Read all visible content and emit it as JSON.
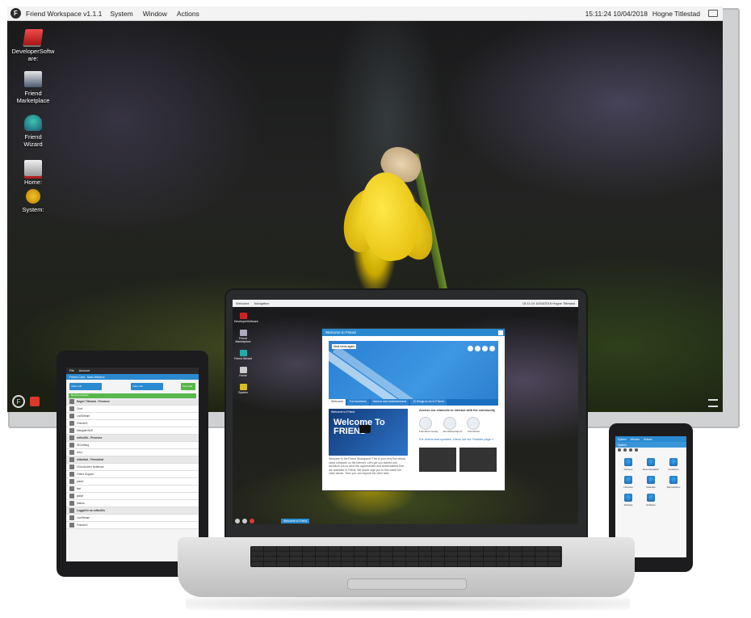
{
  "monitor": {
    "topbar": {
      "app_title": "Friend Workspace v1.1.1",
      "menus": [
        "System",
        "Window",
        "Actions"
      ],
      "clock": "15:11:24 10/04/2018",
      "user": "Hogne Titlestad"
    },
    "desktop_icons": [
      {
        "label": "DeveloperSoftware:",
        "icon": "developer-software-icon"
      },
      {
        "label": "Friend Marketplace",
        "icon": "marketplace-icon"
      },
      {
        "label": "Friend Wizard",
        "icon": "wizard-icon"
      },
      {
        "label": "Home:",
        "icon": "home-drive-icon"
      },
      {
        "label": "System:",
        "icon": "system-drive-icon"
      }
    ]
  },
  "laptop": {
    "topbar": {
      "menus": [
        "Welcome",
        "Navigation"
      ],
      "clock_user": "15:11:24 10/04/2018 Hogne Titlestad"
    },
    "desktop_icons": [
      "DeveloperSoftware",
      "Friend Marketplace",
      "Friend Wizard",
      "Home",
      "System"
    ],
    "window": {
      "title": "Welcome to Friend",
      "news_label": "Neat news again",
      "tabs": [
        "Welcome",
        "For business",
        "Games and entertainment",
        "10 things to do in Friend"
      ],
      "video_title": "Welcome To FRIEND",
      "video_caption": "Welcome to Friend",
      "channels_heading": "Access our channels to interact with the community",
      "channels": [
        "FriendCommunity",
        "FriendDevelopers",
        "FriendChat"
      ],
      "videos_heading": "For videos and updates, check out our Youtube page »",
      "intro_text": "Welcome to the Friend Workspace! This is your very first virtual cloud computer on the internet. Let's get you started and introduce you to all of the opportunities and functionalities that are available in Friend. We would urge you to first watch the video above. Then you can explore the other tabs."
    },
    "taskbar_item": "Welcome to Friend"
  },
  "tablet": {
    "menus": [
      "File",
      "Account"
    ],
    "header": "Friend Chat - Main Window",
    "buttons": [
      "Video call",
      "Voice call",
      "Text chat"
    ],
    "notice": "Recent contacts",
    "rows": [
      {
        "label": "Hogne Titlestad - Presence",
        "group": true
      },
      {
        "label": "Chat",
        "group": false
      },
      {
        "label": "LiveStream",
        "group": false
      },
      {
        "label": "FriendUS",
        "group": false
      },
      {
        "label": "Mangata Wolf",
        "group": false
      },
      {
        "label": "rolfsn20n - Presence",
        "group": true
      },
      {
        "label": "IRCnetting",
        "group": false
      },
      {
        "label": "Artur",
        "group": false
      },
      {
        "label": "olitestiad - Friendchat",
        "group": true
      },
      {
        "label": "Chris Andre's Notebook",
        "group": false
      },
      {
        "label": "Friend Support",
        "group": false
      },
      {
        "label": "pawel",
        "group": false
      },
      {
        "label": "test",
        "group": false
      },
      {
        "label": "jxdkel",
        "group": false
      },
      {
        "label": "Marius",
        "group": false
      },
      {
        "label": "Logged in as rolfsn20n",
        "group": true
      },
      {
        "label": "LiveStream",
        "group": false
      },
      {
        "label": "FriendUS",
        "group": false
      }
    ]
  },
  "phone": {
    "menus": [
      "System",
      "Window",
      "Actions"
    ],
    "title": "System",
    "apps": [
      "Devices",
      "Documentation",
      "Functions",
      "Libraries",
      "Modules",
      "Repositories",
      "Settings",
      "Software"
    ]
  }
}
